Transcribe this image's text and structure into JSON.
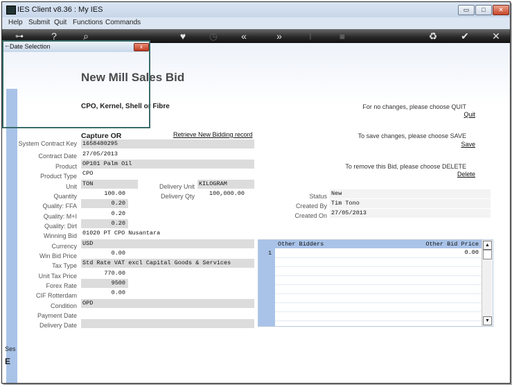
{
  "window": {
    "title": "IES Client v8.36 : My IES",
    "min_label": "▭",
    "max_label": "□",
    "close_label": "✕"
  },
  "menu": {
    "items": [
      "Help",
      "Submit",
      "Quit",
      "Functions",
      "Commands"
    ]
  },
  "dialog": {
    "title": "Date Selection",
    "close_label": "x"
  },
  "page": {
    "title": "New Mill Sales Bid",
    "subtitle": "CPO, Kernel, Shell or Fibre",
    "capture": "Capture OR",
    "retrieve_link": "Retrieve New Bidding record"
  },
  "form": {
    "labels": {
      "contract_key": "System Contract Key",
      "contract_date": "Contract Date",
      "product": "Product",
      "product_type": "Product Type",
      "unit": "Unit",
      "quantity": "Quantity",
      "quality_ffa": "Quality: FFA",
      "quality_mi": "Quality: M+I",
      "quality_dirt": "Quality: Dirt",
      "winning_bid": "Winning Bid",
      "currency": "Currency",
      "win_bid_price": "Win Bid Price",
      "tax_type": "Tax Type",
      "unit_tax_price": "Unit Tax Price",
      "forex_rate": "Forex Rate",
      "cif_rotterdam": "CIF Rotterdam",
      "condition": "Condition",
      "payment_date": "Payment Date",
      "delivery_date": "Delivery Date",
      "delivery_unit": "Delivery Unit",
      "delivery_qty": "Delivery Qty"
    },
    "values": {
      "contract_key": "1658480295",
      "contract_date": "27/05/2013",
      "product": "OP101 Palm Oil",
      "product_type": "CPO",
      "unit": "TON",
      "quantity": "100.00",
      "quality_ffa": "0.20",
      "quality_mi": "0.20",
      "quality_dirt": "0.20",
      "winning_bid": "01020 PT CPO Nusantara",
      "currency": "USD",
      "win_bid_price": "0.00",
      "tax_type": "Std Rate VAT excl Capital Goods & Services",
      "unit_tax_price": "770.00",
      "forex_rate": "9500",
      "cif_rotterdam": "0.00",
      "condition": "OPD",
      "payment_date": "",
      "delivery_date": "",
      "delivery_unit": "KILOGRAM",
      "delivery_qty": "100,000.00"
    }
  },
  "actions": {
    "quit_text": "For no changes, please choose QUIT",
    "quit_link": "Quit",
    "save_text": "To save changes, please choose SAVE",
    "save_link": "Save",
    "delete_text": "To remove this Bid,  please choose  DELETE",
    "delete_link": "Delete"
  },
  "status": {
    "status_label": "Status",
    "status_value": "New",
    "created_by_label": "Created By",
    "created_by_value": "Tim Tono",
    "created_on_label": "Created On",
    "created_on_value": "27/05/2013"
  },
  "bidders": {
    "col_bidders": "Other Bidders",
    "col_price": "Other Bid Price",
    "rows": [
      {
        "num": "1",
        "bidder": "",
        "price": "0.00"
      }
    ]
  },
  "sidebar": {
    "bottom_text": "Ses",
    "bottom_glyph": "E"
  },
  "icons": [
    "key-icon",
    "help-icon",
    "search-icon",
    "heart-icon",
    "clock-icon",
    "rewind-icon",
    "forward-icon",
    "text-cursor-icon",
    "stop-icon",
    "recycle-icon",
    "check-icon",
    "close-icon"
  ]
}
